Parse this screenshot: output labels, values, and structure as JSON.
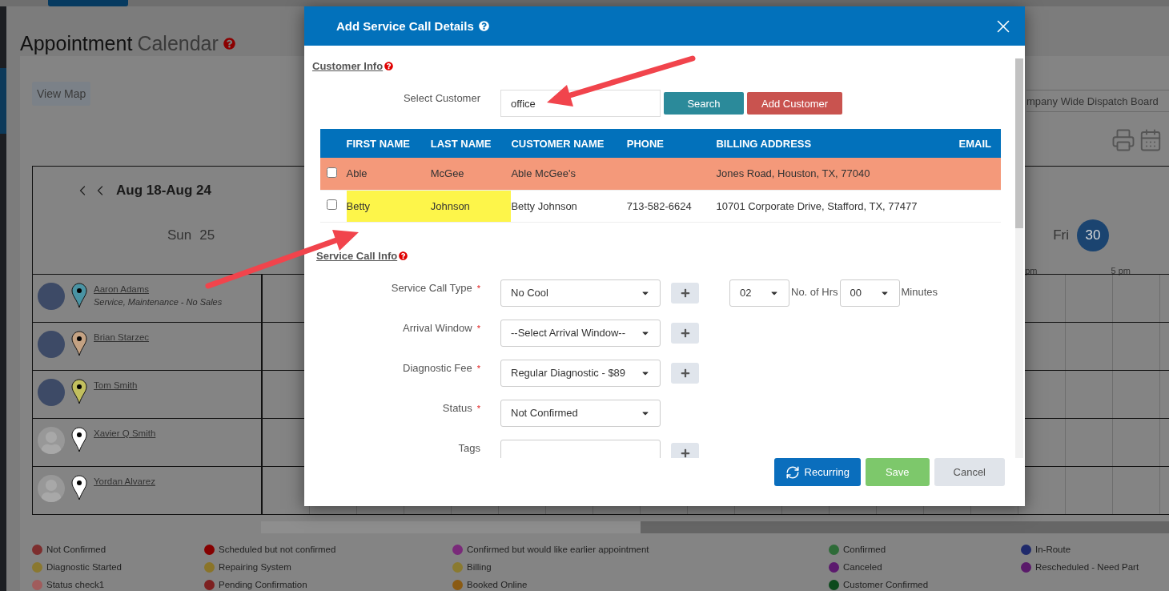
{
  "page": {
    "title_main": "Appointment",
    "title_sub": "Calendar",
    "view_map": "View Map",
    "board_select": "mpany Wide Dispatch Board"
  },
  "calendar": {
    "range": "Aug 18-Aug 24",
    "days": [
      {
        "name": "Sun",
        "date": "25",
        "selected": false
      },
      {
        "name": "Fri",
        "date": "30",
        "selected": true
      }
    ],
    "time_labels": [
      "pm",
      "5 pm"
    ],
    "technicians": [
      {
        "name": "Aaron Adams",
        "skills": "Service, Maintenance - No Sales",
        "photo": true,
        "color": "#4a93a3"
      },
      {
        "name": "Brian Starzec",
        "photo": true,
        "color": "#c4a283"
      },
      {
        "name": "Tom Smith",
        "photo": true,
        "color": "#c2bf5e"
      },
      {
        "name": "Xavier Q Smith",
        "photo": false,
        "color": "#ffffff"
      },
      {
        "name": "Yordan Alvarez",
        "photo": false,
        "color": "#ffffff"
      }
    ]
  },
  "legend": [
    {
      "label": "Not Confirmed",
      "color": "#7d2e2e"
    },
    {
      "label": "Scheduled but not confirmed",
      "color": "#850000"
    },
    {
      "label": "Confirmed but would like earlier appointment",
      "color": "#7a2a7a"
    },
    {
      "label": "Confirmed",
      "color": "#2e6b38"
    },
    {
      "label": "In-Route",
      "color": "#1f2a6b"
    },
    {
      "label": "Diagnostic Started",
      "color": "#8a7830"
    },
    {
      "label": "Repairing System",
      "color": "#8a7428"
    },
    {
      "label": "Billing",
      "color": "#8a7a30"
    },
    {
      "label": "Canceled",
      "color": "#5c1a6e"
    },
    {
      "label": "Rescheduled - Need Part",
      "color": "#5a1a6a"
    },
    {
      "label": "Status check1",
      "color": "#a05c5c"
    },
    {
      "label": "Pending Confirmation",
      "color": "#7d2020"
    },
    {
      "label": "Booked Online",
      "color": "#8a5a12"
    },
    {
      "label": "Customer Confirmed",
      "color": "#0c4a1c"
    }
  ],
  "modal": {
    "title": "Add Service Call Details",
    "customer_section": "Customer Info",
    "select_label": "Select Customer",
    "search_value": "office",
    "search_button": "Search",
    "add_button": "Add Customer",
    "table": {
      "columns": [
        "FIRST NAME",
        "LAST NAME",
        "CUSTOMER NAME",
        "PHONE",
        "BILLING ADDRESS",
        "EMAIL"
      ],
      "rows": [
        {
          "checked": false,
          "color": "#f4997a",
          "highlight": false,
          "first_name": "Able",
          "last_name": "McGee",
          "customer_name": "Able McGee's",
          "billing_address": "Jones Road, Houston, TX, 77040"
        },
        {
          "checked": false,
          "highlight": true,
          "first_name": "Betty",
          "last_name": "Johnson",
          "customer_name": "Betty Johnson",
          "phone": "713-582-6624",
          "billing_address": "10701 Corporate Drive, Stafford, TX, 77477"
        }
      ]
    },
    "service_section": "Service Call Info",
    "required_mark": "*",
    "fields": [
      {
        "label": "Service Call Type",
        "required": true,
        "kind": "select",
        "value": "No Cool",
        "addable": true,
        "duration": {
          "hours": "02",
          "hours_label": "No. of Hrs",
          "minutes": "00",
          "minutes_label": "Minutes"
        }
      },
      {
        "label": "Arrival Window",
        "required": true,
        "kind": "select",
        "value": "--Select Arrival Window--",
        "addable": true
      },
      {
        "label": "Diagnostic Fee",
        "required": true,
        "kind": "select",
        "value": "Regular Diagnostic - $89",
        "addable": true
      },
      {
        "label": "Status",
        "required": true,
        "kind": "select",
        "value": "Not Confirmed",
        "addable": false
      },
      {
        "label": "Tags",
        "required": false,
        "kind": "text",
        "addable": true
      }
    ],
    "buttons": [
      {
        "label": "Recurring",
        "kind": "primary"
      },
      {
        "label": "Save",
        "kind": "success"
      },
      {
        "label": "Cancel",
        "kind": "default"
      }
    ]
  }
}
